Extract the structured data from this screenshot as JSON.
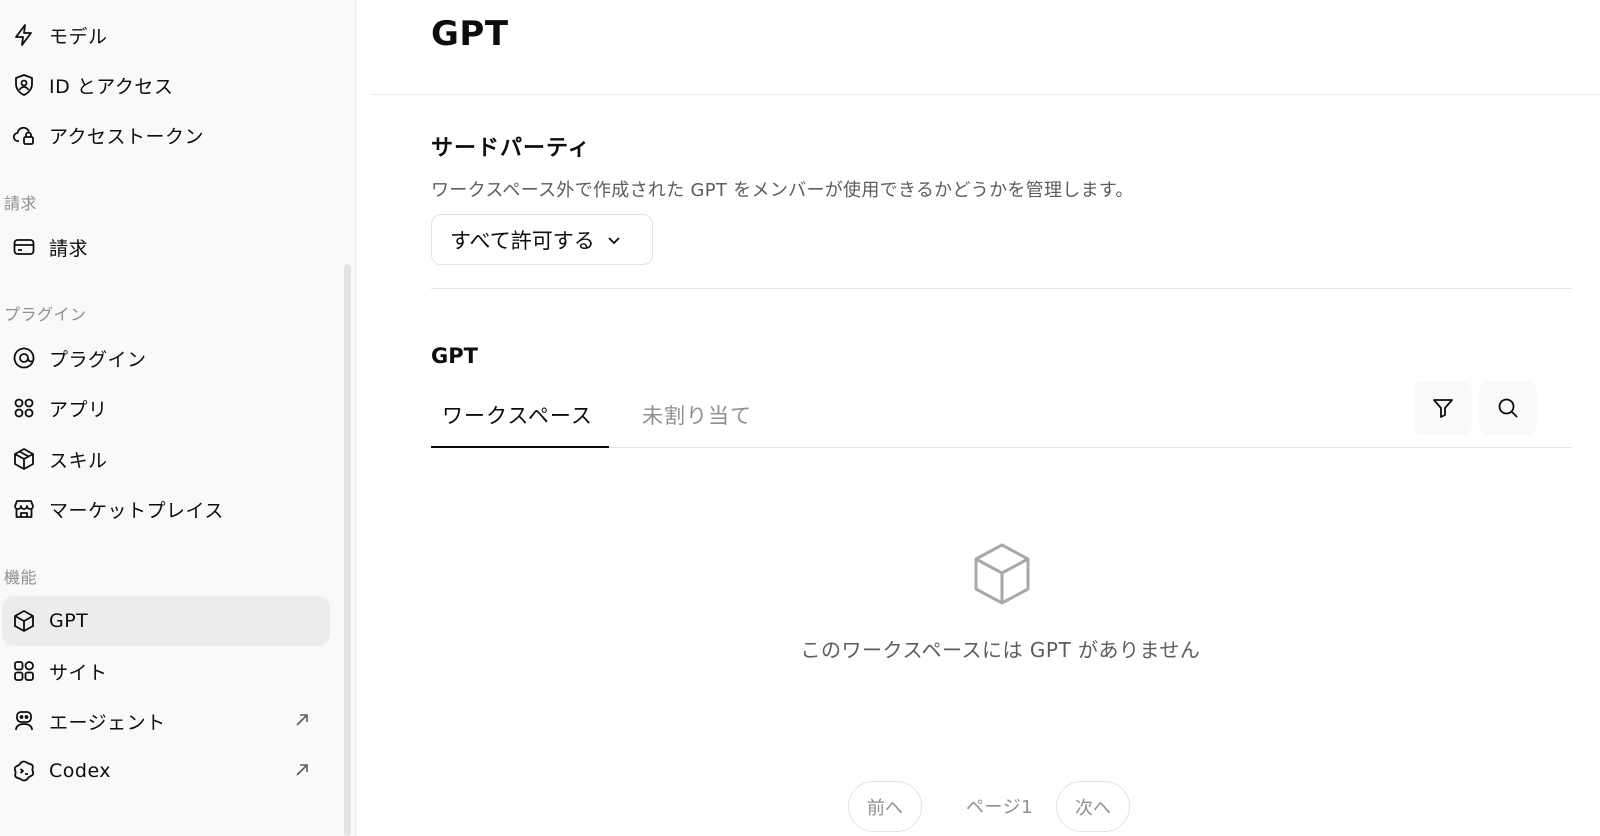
{
  "sidebar": {
    "top_items": [
      {
        "label": "モデル",
        "icon": "lightning-icon"
      },
      {
        "label": "ID とアクセス",
        "icon": "shield-user-icon"
      },
      {
        "label": "アクセストークン",
        "icon": "cloud-lock-icon"
      }
    ],
    "sections": {
      "billing": "請求",
      "plugins": "プラグイン",
      "features": "機能"
    },
    "billing_items": [
      {
        "label": "請求",
        "icon": "credit-card-icon"
      }
    ],
    "plugin_items": [
      {
        "label": "プラグイン",
        "icon": "plugin-icon"
      },
      {
        "label": "アプリ",
        "icon": "apps-icon"
      },
      {
        "label": "スキル",
        "icon": "skill-cube-icon"
      },
      {
        "label": "マーケットプレイス",
        "icon": "store-icon"
      }
    ],
    "feature_items": [
      {
        "label": "GPT",
        "icon": "cube-icon",
        "active": true
      },
      {
        "label": "サイト",
        "icon": "sites-grid-icon"
      },
      {
        "label": "エージェント",
        "icon": "robot-icon",
        "external": true
      },
      {
        "label": "Codex",
        "icon": "codex-icon",
        "external": true
      }
    ]
  },
  "main": {
    "title": "GPT",
    "third_party": {
      "title": "サードパーティ",
      "description": "ワークスペース外で作成された GPT をメンバーが使用できるかどうかを管理します。",
      "dropdown_value": "すべて許可する"
    },
    "gpt_section": {
      "title": "GPT",
      "tabs": [
        "ワークスペース",
        "未割り当て"
      ],
      "active_tab": "ワークスペース",
      "empty_message": "このワークスペースには GPT がありません"
    },
    "pagination": {
      "prev": "前へ",
      "page_label": "ページ1",
      "next": "次へ"
    }
  },
  "colors": {
    "text": "#0d0d0d",
    "muted": "#8f8f8f",
    "border": "#e3e3e3",
    "active_bg": "#ececec"
  }
}
